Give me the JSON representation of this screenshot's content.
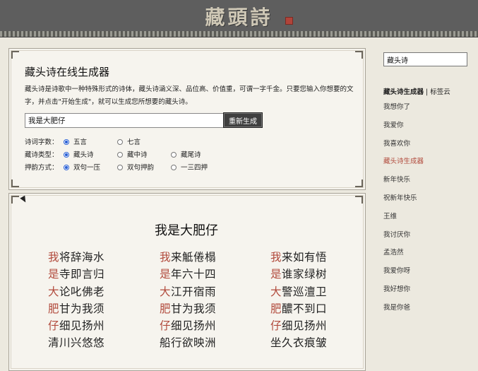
{
  "header": {
    "logo_text": "藏頭詩"
  },
  "generator": {
    "title": "藏头诗在线生成器",
    "description": "藏头诗是诗歌中一种特殊形式的诗体，藏头诗涵义深、品位高、价值重，可谓一字千金。只要您输入你想要的文字，并点击\"开始生成\"，就可以生成您所想要的藏头诗。",
    "input_value": "我是大肥仔",
    "button_label": "重新生成",
    "options": [
      {
        "label": "诗词字数：",
        "choices": [
          {
            "text": "五言",
            "selected": true
          },
          {
            "text": "七言",
            "selected": false
          }
        ]
      },
      {
        "label": "藏诗类型：",
        "choices": [
          {
            "text": "藏头诗",
            "selected": true
          },
          {
            "text": "藏中诗",
            "selected": false
          },
          {
            "text": "藏尾诗",
            "selected": false
          }
        ]
      },
      {
        "label": "押韵方式：",
        "choices": [
          {
            "text": "双句一压",
            "selected": true
          },
          {
            "text": "双句押韵",
            "selected": false
          },
          {
            "text": "一三四押",
            "selected": false
          }
        ]
      }
    ]
  },
  "result": {
    "title": "我是大肥仔",
    "poems": [
      {
        "lines": [
          {
            "head": "我",
            "rest": "将辞海水"
          },
          {
            "head": "是",
            "rest": "寺即言归"
          },
          {
            "head": "大",
            "rest": "论叱佛老"
          },
          {
            "head": "肥",
            "rest": "甘为我须"
          },
          {
            "head": "仔",
            "rest": "细见扬州"
          },
          {
            "head": "",
            "rest": "清川兴悠悠"
          }
        ]
      },
      {
        "lines": [
          {
            "head": "我",
            "rest": "来觝倦榻"
          },
          {
            "head": "是",
            "rest": "年六十四"
          },
          {
            "head": "大",
            "rest": "江开宿雨"
          },
          {
            "head": "肥",
            "rest": "甘为我须"
          },
          {
            "head": "仔",
            "rest": "细见扬州"
          },
          {
            "head": "",
            "rest": "船行欲映洲"
          }
        ]
      },
      {
        "lines": [
          {
            "head": "我",
            "rest": "来如有悟"
          },
          {
            "head": "是",
            "rest": "谁家绿树"
          },
          {
            "head": "大",
            "rest": "警巡澶卫"
          },
          {
            "head": "肥",
            "rest": "醲不到口"
          },
          {
            "head": "仔",
            "rest": "细见扬州"
          },
          {
            "head": "",
            "rest": "坐久衣痕皱"
          }
        ]
      }
    ]
  },
  "sidebar": {
    "search_value": "藏头诗",
    "heading_main": "藏头诗生成器",
    "heading_sep": " | ",
    "heading_sub": "标签云",
    "links": [
      {
        "text": "我想你了",
        "active": false
      },
      {
        "text": "我爱你",
        "active": false
      },
      {
        "text": "我喜欢你",
        "active": false
      },
      {
        "text": "藏头诗生成器",
        "active": true
      },
      {
        "text": "新年快乐",
        "active": false
      },
      {
        "text": "祝新年快乐",
        "active": false
      },
      {
        "text": "王维",
        "active": false
      },
      {
        "text": "我讨厌你",
        "active": false
      },
      {
        "text": "孟浩然",
        "active": false
      },
      {
        "text": "我爱你呀",
        "active": false
      },
      {
        "text": "我好想你",
        "active": false
      },
      {
        "text": "我是你爸",
        "active": false
      }
    ]
  },
  "colors": {
    "accent": "#b14a3c",
    "topbar": "#5e5e5e",
    "page_bg": "#ece9df"
  }
}
